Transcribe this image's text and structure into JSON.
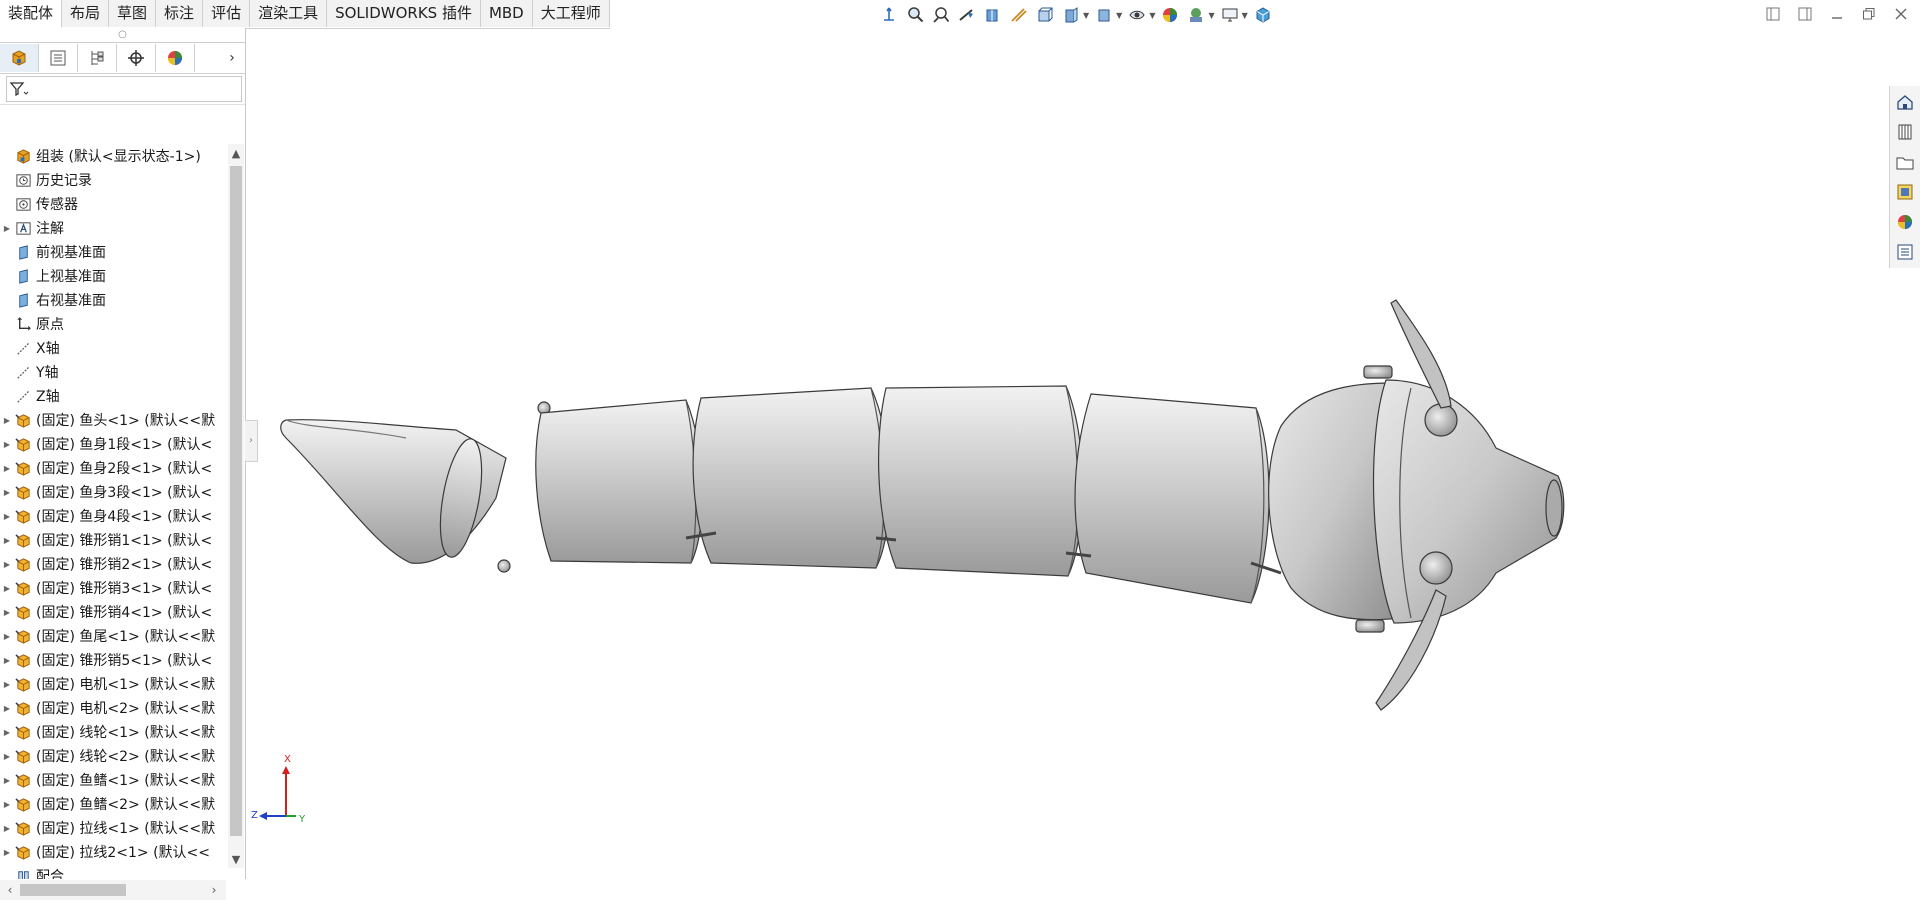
{
  "tabs": [
    {
      "label": "装配体",
      "active": true
    },
    {
      "label": "布局"
    },
    {
      "label": "草图"
    },
    {
      "label": "标注"
    },
    {
      "label": "评估"
    },
    {
      "label": "渲染工具"
    },
    {
      "label": "SOLIDWORKS 插件"
    },
    {
      "label": "MBD"
    },
    {
      "label": "大工程师"
    }
  ],
  "headsup_icons": [
    "move-triad-icon",
    "zoom-to-fit-icon",
    "zoom-area-icon",
    "previous-view-icon",
    "section-view-icon",
    "dynamic-annotation-icon",
    "view-orientation-icon",
    "display-style-icon",
    "hide-show-icon",
    "edit-appearance-icon",
    "apply-scene-icon",
    "view-settings-icon",
    "3d-view-icon"
  ],
  "window_icons": [
    "tile-left-icon",
    "tile-right-icon",
    "minimize-icon",
    "restore-icon",
    "close-icon"
  ],
  "panel_tabs": [
    "featuremanager-icon",
    "propertymanager-icon",
    "configurationmanager-icon",
    "dimxpert-icon",
    "displaymanager-icon"
  ],
  "tree": {
    "root": "组装  (默认<显示状态-1>)",
    "items": [
      {
        "label": "历史记录",
        "icon": "history-icon",
        "expand": false
      },
      {
        "label": "传感器",
        "icon": "sensor-icon",
        "expand": false
      },
      {
        "label": "注解",
        "icon": "annotation-icon",
        "expand": true
      },
      {
        "label": "前视基准面",
        "icon": "plane-icon",
        "expand": false
      },
      {
        "label": "上视基准面",
        "icon": "plane-icon",
        "expand": false
      },
      {
        "label": "右视基准面",
        "icon": "plane-icon",
        "expand": false
      },
      {
        "label": "原点",
        "icon": "origin-icon",
        "expand": false
      },
      {
        "label": "X轴",
        "icon": "axis-icon",
        "expand": false
      },
      {
        "label": "Y轴",
        "icon": "axis-icon",
        "expand": false
      },
      {
        "label": "Z轴",
        "icon": "axis-icon",
        "expand": false
      },
      {
        "label": "(固定) 鱼头<1> (默认<<默",
        "icon": "part-icon",
        "expand": true
      },
      {
        "label": "(固定) 鱼身1段<1> (默认<",
        "icon": "part-icon",
        "expand": true
      },
      {
        "label": "(固定) 鱼身2段<1> (默认<",
        "icon": "part-icon",
        "expand": true
      },
      {
        "label": "(固定) 鱼身3段<1> (默认<",
        "icon": "part-icon",
        "expand": true
      },
      {
        "label": "(固定) 鱼身4段<1> (默认<",
        "icon": "part-icon",
        "expand": true
      },
      {
        "label": "(固定) 锥形销1<1> (默认<",
        "icon": "part-icon",
        "expand": true
      },
      {
        "label": "(固定) 锥形销2<1> (默认<",
        "icon": "part-icon",
        "expand": true
      },
      {
        "label": "(固定) 锥形销3<1> (默认<",
        "icon": "part-icon",
        "expand": true
      },
      {
        "label": "(固定) 锥形销4<1> (默认<",
        "icon": "part-icon",
        "expand": true
      },
      {
        "label": "(固定) 鱼尾<1> (默认<<默",
        "icon": "part-icon",
        "expand": true
      },
      {
        "label": "(固定) 锥形销5<1> (默认<",
        "icon": "part-icon",
        "expand": true
      },
      {
        "label": "(固定) 电机<1> (默认<<默",
        "icon": "part-icon",
        "expand": true
      },
      {
        "label": "(固定) 电机<2> (默认<<默",
        "icon": "part-icon",
        "expand": true
      },
      {
        "label": "(固定) 线轮<1> (默认<<默",
        "icon": "part-icon",
        "expand": true
      },
      {
        "label": "(固定) 线轮<2> (默认<<默",
        "icon": "part-icon",
        "expand": true
      },
      {
        "label": "(固定) 鱼鳍<1> (默认<<默",
        "icon": "part-icon",
        "expand": true
      },
      {
        "label": "(固定) 鱼鳍<2> (默认<<默",
        "icon": "part-icon",
        "expand": true
      },
      {
        "label": "(固定) 拉线<1> (默认<<默",
        "icon": "part-icon",
        "expand": true
      },
      {
        "label": "(固定) 拉线2<1> (默认<<",
        "icon": "part-icon",
        "expand": true
      },
      {
        "label": "配合",
        "icon": "mates-icon",
        "expand": false
      }
    ]
  },
  "taskpane_icons": [
    "home-icon",
    "design-library-icon",
    "file-explorer-icon",
    "view-palette-icon",
    "appearances-icon",
    "custom-properties-icon"
  ],
  "triad": {
    "x": "X",
    "y": "Y",
    "z": "Z"
  },
  "colors": {
    "accent": "#1f6fd1",
    "part": "#e8a020",
    "model": "#cfcfcf"
  }
}
